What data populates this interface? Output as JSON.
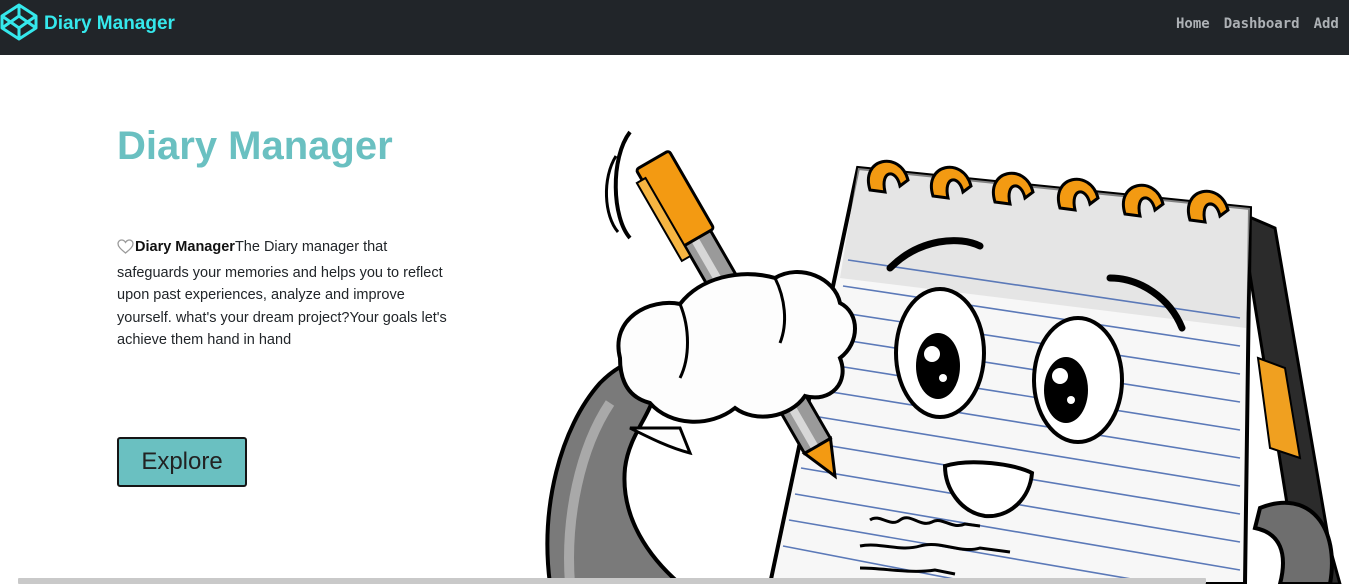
{
  "navbar": {
    "brand": "Diary Manager",
    "brand_icon": "codepen-cube-icon",
    "links": [
      "Home",
      "Dashboard",
      "Add"
    ]
  },
  "hero": {
    "title": "Diary Manager",
    "description_icon": "heart-outline-icon",
    "description_bold": "Diary Manager",
    "description_text": "The Diary manager that safeguards your memories and helps you to reflect upon past experiences, analyze and improve yourself. what's your dream project?Your goals let's achieve them hand in hand",
    "button_label": "Explore",
    "illustration": "cartoon-notebook-holding-pen-image"
  },
  "colors": {
    "navbar_bg": "#212529",
    "brand": "#35e8ec",
    "nav_link": "#adb1b5",
    "title": "#6ac0c1",
    "button_bg": "#6ac0c1"
  }
}
